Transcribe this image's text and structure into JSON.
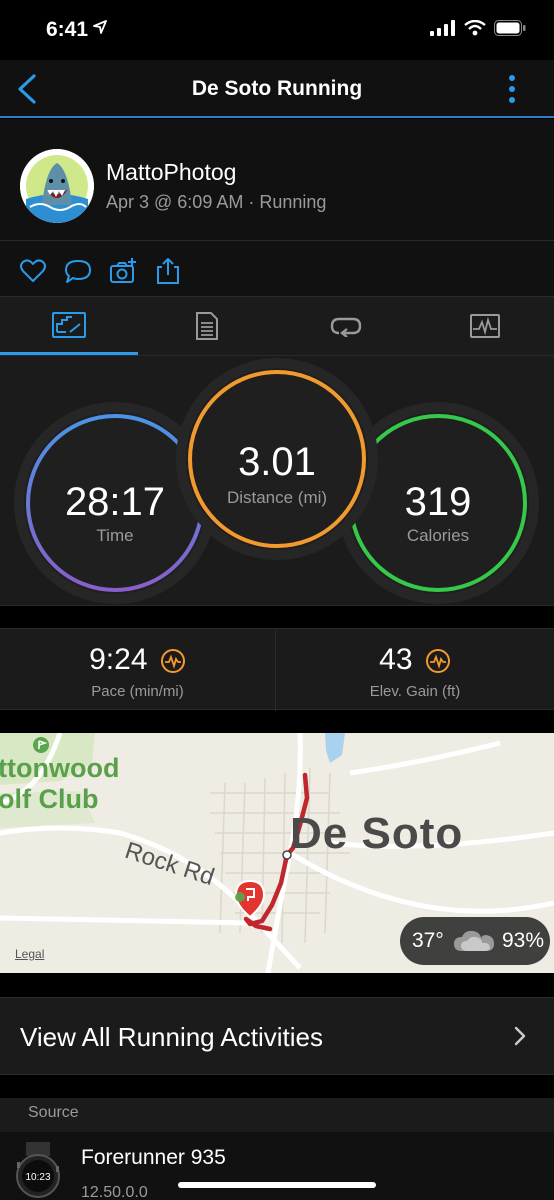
{
  "status_bar": {
    "time": "6:41"
  },
  "nav": {
    "title": "De Soto Running",
    "back_icon": "chevron-left-icon",
    "menu_icon": "more-vertical-icon"
  },
  "profile": {
    "name": "MattoPhotog",
    "subtitle": "Apr 3 @ 6:09 AM · Running"
  },
  "actions": [
    "heart-icon",
    "comment-icon",
    "add-photo-icon",
    "share-icon"
  ],
  "tabs": [
    "summary-tab-icon",
    "details-tab-icon",
    "laps-tab-icon",
    "charts-tab-icon"
  ],
  "summary": {
    "time": {
      "value": "28:17",
      "label": "Time",
      "color": "#6f74d9"
    },
    "distance": {
      "value": "3.01",
      "label": "Distance (mi)",
      "color": "#f39a2e"
    },
    "calories": {
      "value": "319",
      "label": "Calories",
      "color": "#35c84a"
    }
  },
  "stats": {
    "pace": {
      "value": "9:24",
      "label": "Pace (min/mi)"
    },
    "elevation": {
      "value": "43",
      "label": "Elev. Gain (ft)"
    }
  },
  "map": {
    "place_label": "De Soto",
    "road_label": "Rock Rd",
    "golf_label_line1": "ttonwood",
    "golf_label_line2": "olf Club",
    "legal": "Legal",
    "weather": {
      "temp": "37°",
      "humidity": "93%"
    }
  },
  "view_all": {
    "label": "View All Running Activities"
  },
  "source": {
    "header": "Source",
    "device_name": "Forerunner 935",
    "version": "12.50.0.0",
    "watch_face_time": "10:23"
  },
  "colors": {
    "accent": "#2b9ae8",
    "route": "#c0272d"
  }
}
